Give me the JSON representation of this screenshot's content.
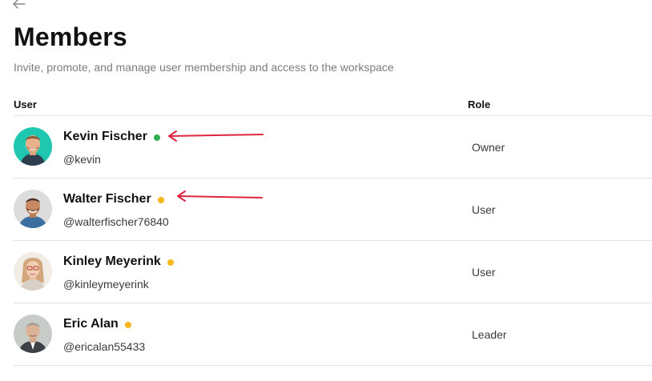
{
  "page": {
    "title": "Members",
    "subtitle": "Invite, promote, and manage user membership and access to the workspace"
  },
  "table": {
    "columns": {
      "user": "User",
      "role": "Role"
    },
    "members": [
      {
        "name": "Kevin Fischer",
        "handle": "@kevin",
        "role": "Owner",
        "status": "online",
        "status_color": "#2fae4e"
      },
      {
        "name": "Walter Fischer",
        "handle": "@walterfischer76840",
        "role": "User",
        "status": "away",
        "status_color": "#f5b71a"
      },
      {
        "name": "Kinley Meyerink",
        "handle": "@kinleymeyerink",
        "role": "User",
        "status": "away",
        "status_color": "#f5b71a"
      },
      {
        "name": "Eric Alan",
        "handle": "@ericalan55433",
        "role": "Leader",
        "status": "away",
        "status_color": "#f5b71a"
      }
    ]
  },
  "icons": {
    "back": "arrow-left-icon"
  },
  "colors": {
    "annotation_arrow": "#e0263f",
    "online": "#2fae4e",
    "away": "#f5b71a",
    "divider": "#e3e3e3"
  }
}
